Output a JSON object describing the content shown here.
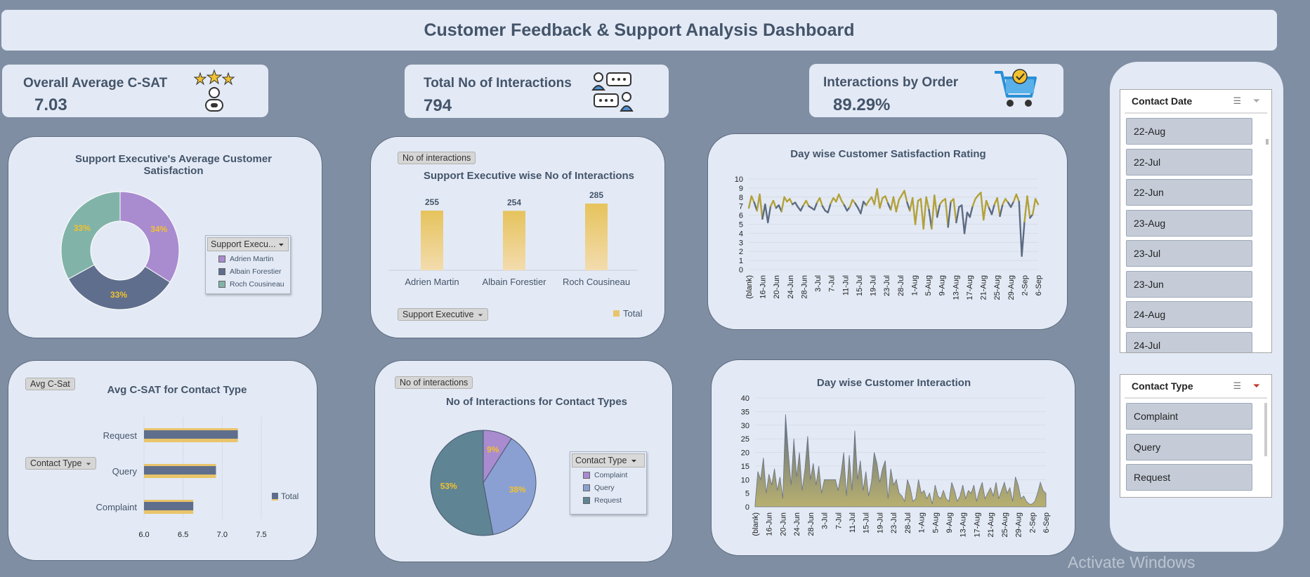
{
  "title": "Customer Feedback & Support Analysis Dashboard",
  "kpis": [
    {
      "label": "Overall Average C-SAT",
      "value": "7.03",
      "icon": "stars-user-icon"
    },
    {
      "label": "Total No of Interactions",
      "value": "794",
      "icon": "chat-people-icon"
    },
    {
      "label": "Interactions by Order",
      "value": "89.29%",
      "icon": "shopping-cart-icon"
    }
  ],
  "colors": {
    "purple": "#a98bd0",
    "navy": "#5f6e8c",
    "teal": "#82b3a8",
    "gold": "#e9c46a",
    "blue": "#8aa0d2",
    "darkteal": "#5f8494",
    "line_dark": "#5d6b82",
    "line_gold": "#b3a13a",
    "area": "#a8a066"
  },
  "donut": {
    "title": "Support Executive's Average Customer Satisfaction",
    "legend_title": "Support Execu...",
    "chart_data": {
      "type": "pie",
      "categories": [
        "Adrien Martin",
        "Albain Forestier",
        "Roch Cousineau"
      ],
      "values": [
        34,
        33,
        33
      ],
      "labels": [
        "34%",
        "33%",
        "33%"
      ]
    }
  },
  "exec_bar": {
    "field_button": "No of interactions",
    "title": "Support Executive wise No of Interactions",
    "axis_button": "Support Executive",
    "legend": "Total",
    "chart_data": {
      "type": "bar",
      "categories": [
        "Adrien Martin",
        "Albain Forestier",
        "Roch Cousineau"
      ],
      "values": [
        255,
        254,
        285
      ]
    }
  },
  "csat_line": {
    "title": "Day wise Customer Satisfaction Rating",
    "chart_data": {
      "type": "line",
      "ylim": [
        0,
        10
      ],
      "yticks": [
        "0",
        "1",
        "2",
        "3",
        "4",
        "5",
        "6",
        "7",
        "8",
        "9",
        "10"
      ],
      "xticks": [
        "(blank)",
        "16-Jun",
        "20-Jun",
        "24-Jun",
        "28-Jun",
        "3-Jul",
        "7-Jul",
        "11-Jul",
        "15-Jul",
        "19-Jul",
        "23-Jul",
        "28-Jul",
        "1-Aug",
        "5-Aug",
        "9-Aug",
        "13-Aug",
        "17-Aug",
        "21-Aug",
        "25-Aug",
        "29-Aug",
        "2-Sep",
        "6-Sep"
      ],
      "values": [
        6.8,
        8.1,
        7.4,
        6.5,
        8.3,
        5.6,
        7.2,
        5.2,
        7.0,
        7.6,
        6.8,
        7.1,
        6.4,
        8.0,
        7.5,
        7.8,
        7.2,
        7.4,
        6.9,
        6.5,
        7.1,
        7.6,
        7.0,
        6.8,
        6.6,
        7.4,
        7.9,
        7.0,
        6.5,
        6.3,
        7.3,
        7.9,
        7.5,
        8.3,
        7.6,
        7.1,
        6.5,
        6.9,
        7.7,
        7.3,
        6.8,
        6.2,
        7.5,
        7.1,
        7.6,
        8.0,
        7.2,
        8.9,
        6.8,
        7.9,
        8.1,
        7.3,
        6.6,
        8.0,
        6.4,
        7.7,
        8.2,
        8.7,
        7.4,
        6.5,
        7.9,
        5.0,
        7.6,
        7.8,
        4.5,
        8.0,
        6.6,
        4.5,
        8.2,
        5.8,
        7.2,
        7.6,
        7.8,
        4.7,
        7.5,
        7.8,
        5.2,
        6.9,
        7.1,
        4.0,
        6.3,
        5.8,
        7.0,
        7.8,
        8.2,
        8.5,
        5.5,
        7.6,
        6.8,
        6.1,
        7.2,
        7.9,
        5.9,
        7.2,
        7.8,
        7.4,
        6.9,
        7.5,
        8.3,
        7.5,
        1.5,
        5.3,
        8.1,
        5.7,
        6.1,
        7.8,
        7.2
      ]
    }
  },
  "ctype_bar": {
    "field_button": "Avg C-Sat",
    "title": "Avg C-SAT for Contact Type",
    "axis_button": "Contact Type",
    "legend": "Total",
    "chart_data": {
      "type": "bar",
      "orientation": "horizontal",
      "categories": [
        "Request",
        "Query",
        "Complaint"
      ],
      "values": [
        7.2,
        6.92,
        6.63
      ],
      "xlim": [
        6.0,
        7.5
      ],
      "xticks": [
        "6.0",
        "6.5",
        "7.0",
        "7.5"
      ]
    }
  },
  "ctype_pie": {
    "field_button": "No of interactions",
    "title": "No of Interactions for Contact Types",
    "legend_title": "Contact Type",
    "chart_data": {
      "type": "pie",
      "categories": [
        "Complaint",
        "Query",
        "Request"
      ],
      "values": [
        9,
        38,
        53
      ],
      "labels": [
        "9%",
        "38%",
        "53%"
      ]
    }
  },
  "interaction_area": {
    "title": "Day wise Customer Interaction",
    "chart_data": {
      "type": "area",
      "ylim": [
        0,
        40
      ],
      "yticks": [
        "0",
        "5",
        "10",
        "15",
        "20",
        "25",
        "30",
        "35",
        "40"
      ],
      "xticks": [
        "(blank)",
        "16-Jun",
        "20-Jun",
        "24-Jun",
        "28-Jun",
        "3-Jul",
        "7-Jul",
        "11-Jul",
        "15-Jul",
        "19-Jul",
        "23-Jul",
        "28-Jul",
        "1-Aug",
        "5-Aug",
        "9-Aug",
        "13-Aug",
        "17-Aug",
        "21-Aug",
        "25-Aug",
        "29-Aug",
        "2-Sep",
        "6-Sep"
      ],
      "values": [
        1,
        13,
        10,
        18,
        5,
        12,
        8,
        14,
        6,
        11,
        3,
        34,
        20,
        8,
        25,
        11,
        20,
        6,
        14,
        26,
        10,
        16,
        8,
        15,
        5,
        10,
        10,
        10,
        10,
        10,
        6,
        12,
        20,
        4,
        19,
        6,
        28,
        10,
        17,
        6,
        13,
        4,
        9,
        20,
        16,
        9,
        14,
        17,
        3,
        14,
        8,
        10,
        5,
        4,
        2,
        10,
        7,
        2,
        3,
        10,
        5,
        6,
        3,
        5,
        1,
        8,
        4,
        3,
        6,
        3,
        2,
        9,
        6,
        2,
        4,
        8,
        3,
        6,
        5,
        8,
        2,
        6,
        9,
        3,
        5,
        7,
        4,
        9,
        3,
        6,
        9,
        5,
        7,
        2,
        11,
        8,
        3,
        4,
        2,
        1,
        1,
        2,
        5,
        9,
        6,
        5
      ]
    }
  },
  "slicer_date": {
    "title": "Contact Date",
    "items": [
      "22-Aug",
      "22-Jul",
      "22-Jun",
      "23-Aug",
      "23-Jul",
      "23-Jun",
      "24-Aug",
      "24-Jul"
    ]
  },
  "slicer_type": {
    "title": "Contact Type",
    "items": [
      "Complaint",
      "Query",
      "Request"
    ]
  },
  "watermark": "Activate Windows"
}
